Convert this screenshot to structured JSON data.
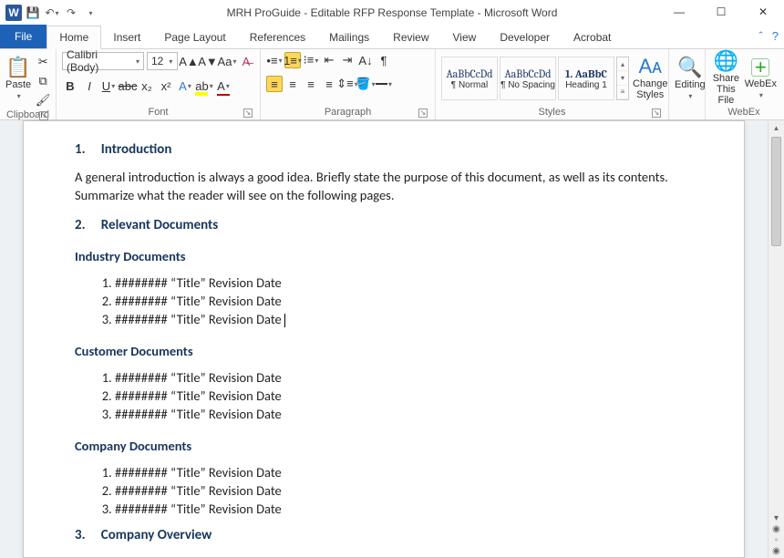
{
  "title": "MRH ProGuide - Editable RFP Response Template - Microsoft Word",
  "tabs": {
    "file": "File",
    "home": "Home",
    "insert": "Insert",
    "pagelayout": "Page Layout",
    "references": "References",
    "mailings": "Mailings",
    "review": "Review",
    "view": "View",
    "developer": "Developer",
    "acrobat": "Acrobat"
  },
  "font": {
    "name": "Calibri (Body)",
    "size": "12"
  },
  "groups": {
    "clipboard": "Clipboard",
    "font": "Font",
    "paragraph": "Paragraph",
    "styles": "Styles",
    "webex": "WebEx"
  },
  "bigbtns": {
    "paste": "Paste",
    "change": "Change\nStyles",
    "editing": "Editing",
    "share": "Share\nThis File",
    "webex": "WebEx"
  },
  "styles": [
    {
      "preview": "AaBbCcDd",
      "name": "¶ Normal"
    },
    {
      "preview": "AaBbCcDd",
      "name": "¶ No Spacing"
    },
    {
      "preview": "1. AaBbC",
      "name": "Heading 1"
    }
  ],
  "doc": {
    "h1_num": "1.",
    "h1": "Introduction",
    "p1": "A general introduction is always a good idea. Briefly state the purpose of this document, as well as its contents. Summarize what the reader will see on the following pages.",
    "h2_num": "2.",
    "h2": "Relevant Documents",
    "sub1": "Industry Documents",
    "sub2": "Customer Documents",
    "sub3": "Company Documents",
    "item": "########  “Title”   Revision   Date",
    "h3_num": "3.",
    "h3": "Company Overview"
  }
}
